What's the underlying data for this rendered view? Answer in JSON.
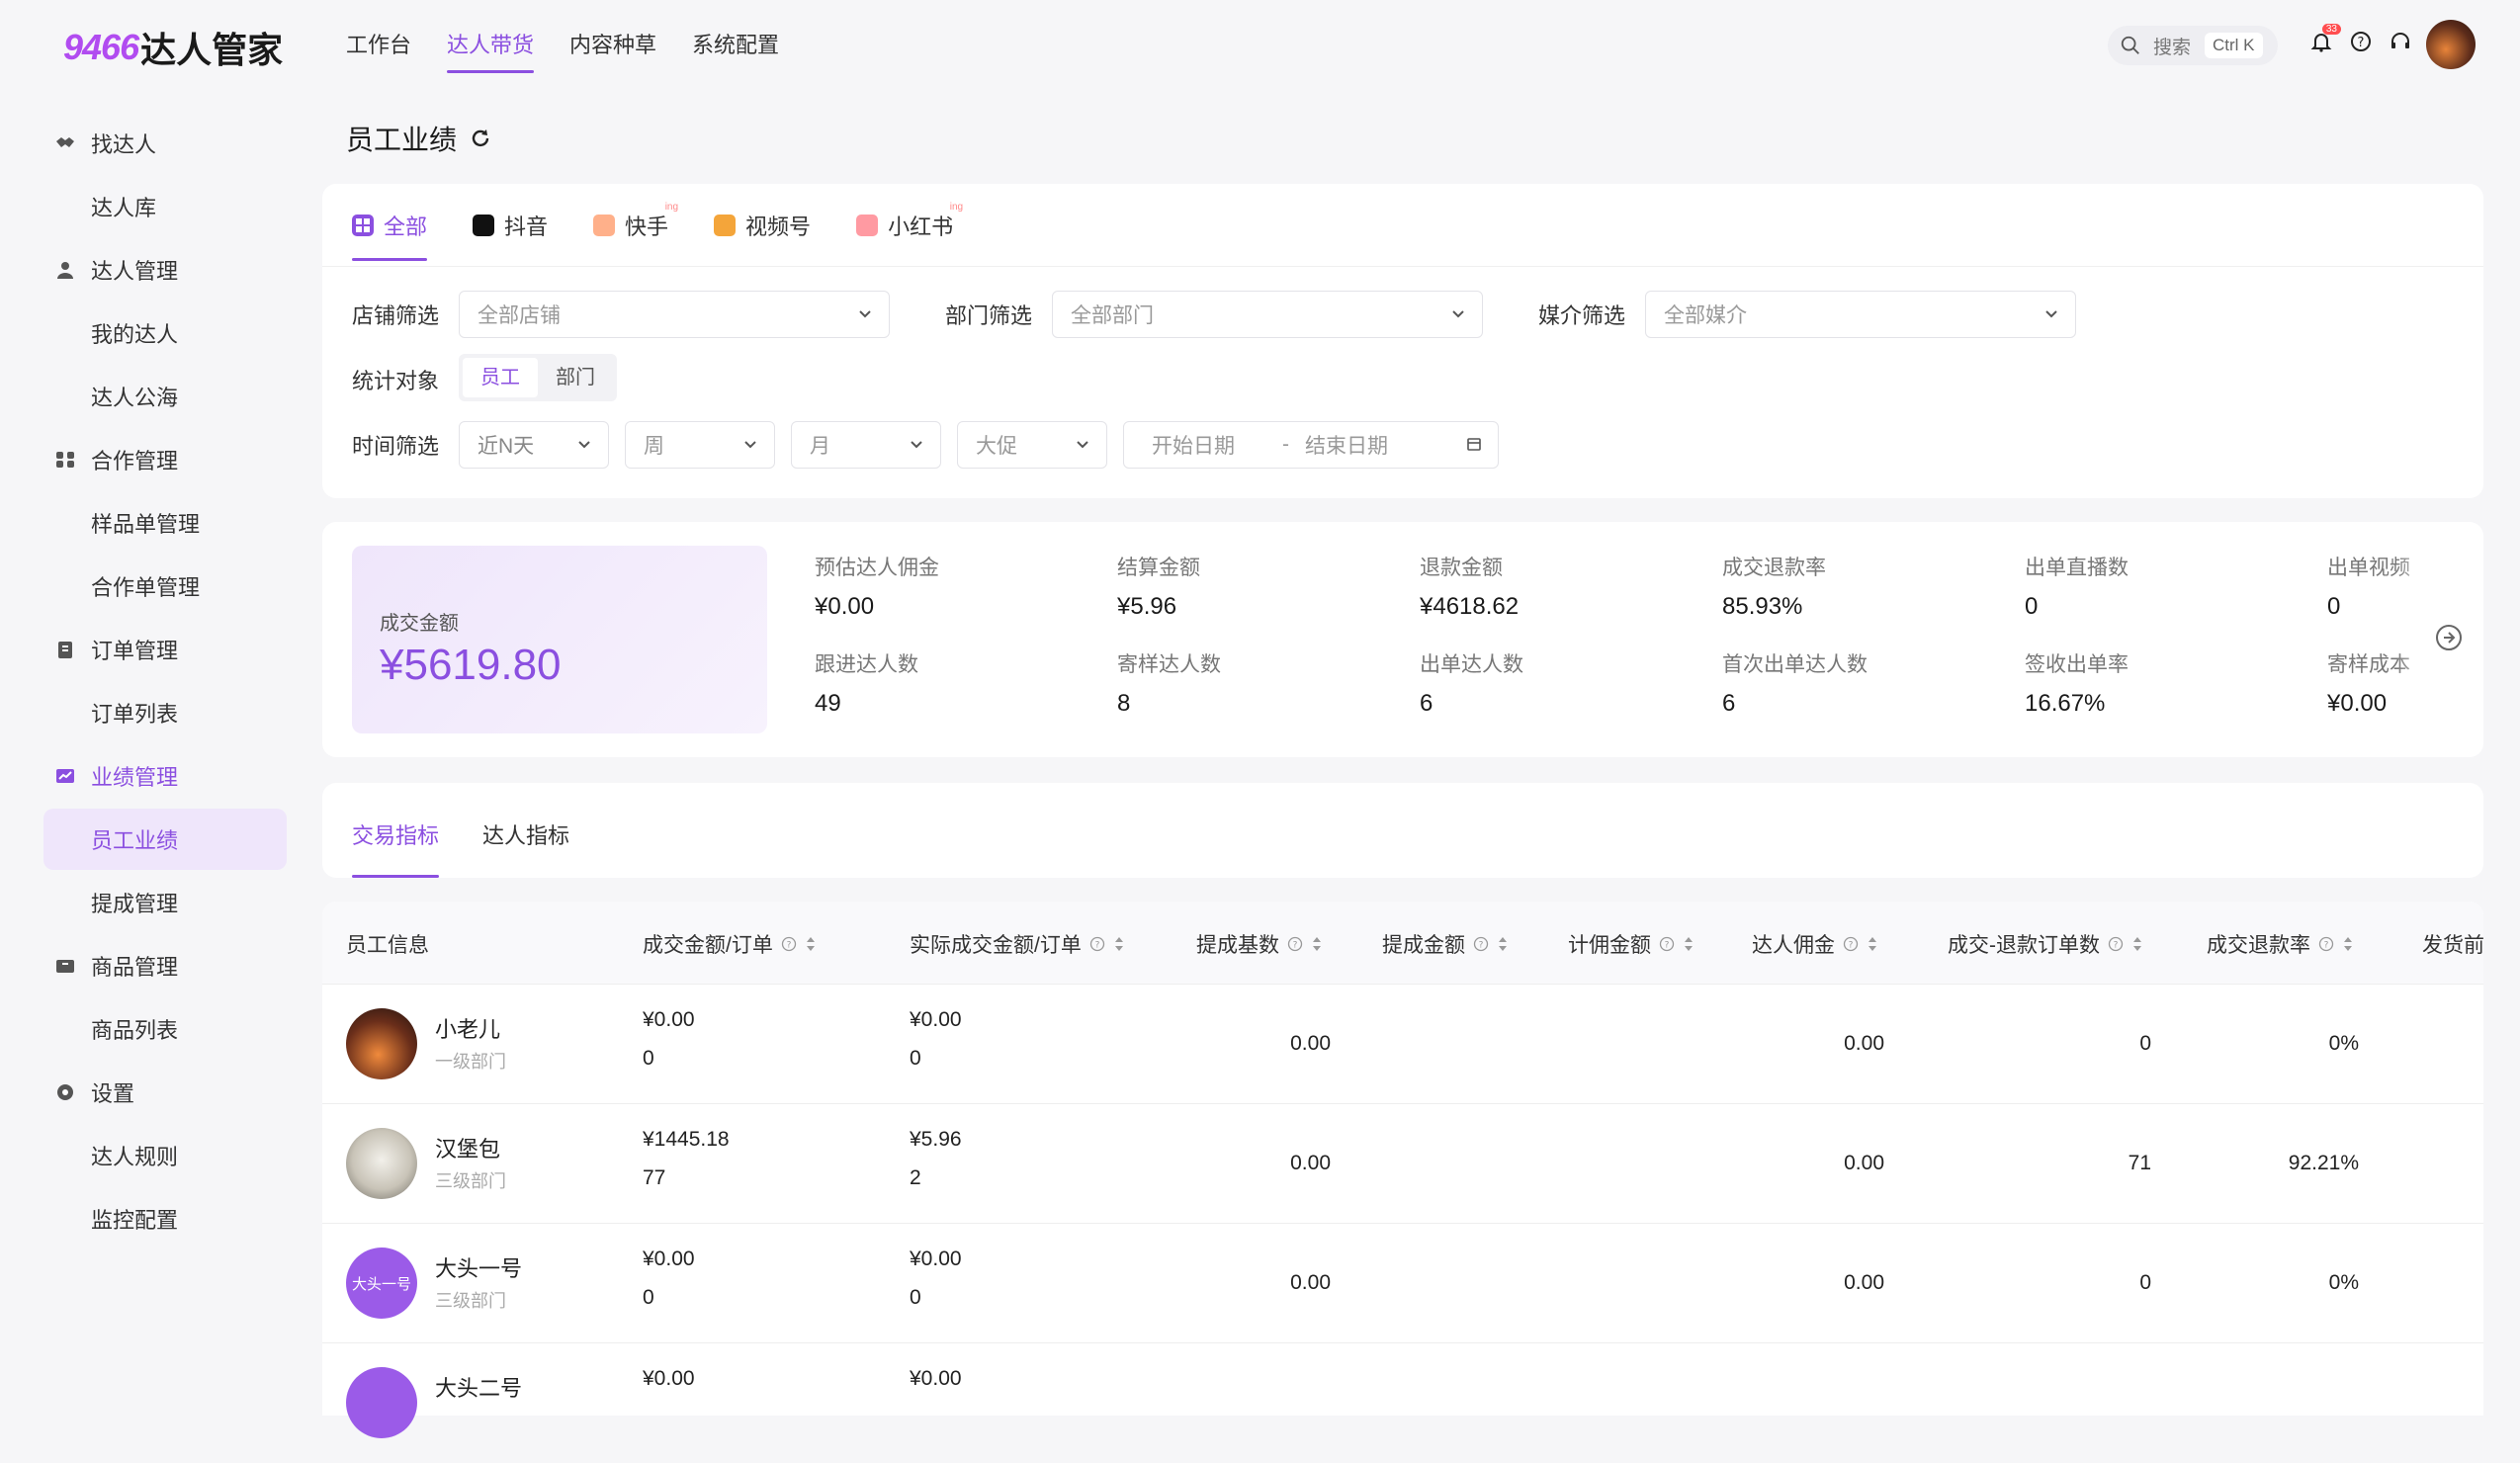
{
  "app": {
    "logo_num": "9466",
    "logo_text": "达人管家",
    "nav": [
      "工作台",
      "达人带货",
      "内容种草",
      "系统配置"
    ],
    "nav_active": "达人带货",
    "search_label": "搜索",
    "search_shortcut": "Ctrl K",
    "notification_count": "33"
  },
  "sidebar": {
    "groups": [
      {
        "label": "找达人",
        "icon": "handshake-icon",
        "items": [
          "达人库"
        ]
      },
      {
        "label": "达人管理",
        "icon": "user-icon",
        "items": [
          "我的达人",
          "达人公海"
        ]
      },
      {
        "label": "合作管理",
        "icon": "team-icon",
        "items": [
          "样品单管理",
          "合作单管理"
        ]
      },
      {
        "label": "订单管理",
        "icon": "clipboard-icon",
        "items": [
          "订单列表"
        ]
      },
      {
        "label": "业绩管理",
        "icon": "chart-icon",
        "items": [
          "员工业绩",
          "提成管理"
        ]
      },
      {
        "label": "商品管理",
        "icon": "box-icon",
        "items": [
          "商品列表"
        ]
      },
      {
        "label": "设置",
        "icon": "gear-icon",
        "items": [
          "达人规则",
          "监控配置"
        ]
      }
    ],
    "active_item": "员工业绩"
  },
  "page": {
    "title": "员工业绩"
  },
  "platforms": [
    {
      "label": "全部",
      "icon": "grid-icon",
      "active": true,
      "tag": ""
    },
    {
      "label": "抖音",
      "icon": "douyin-icon",
      "active": false,
      "tag": ""
    },
    {
      "label": "快手",
      "icon": "kuaishou-icon",
      "active": false,
      "tag": "ing"
    },
    {
      "label": "视频号",
      "icon": "channels-icon",
      "active": false,
      "tag": ""
    },
    {
      "label": "小红书",
      "icon": "xiaohongshu-icon",
      "active": false,
      "tag": "ing"
    }
  ],
  "filters": {
    "shop_label": "店铺筛选",
    "shop_placeholder": "全部店铺",
    "dept_label": "部门筛选",
    "dept_placeholder": "全部部门",
    "agency_label": "媒介筛选",
    "agency_placeholder": "全部媒介",
    "target_label": "统计对象",
    "target_options": [
      "员工",
      "部门"
    ],
    "target_active": "员工",
    "time_label": "时间筛选",
    "time_selects": [
      "近N天",
      "周",
      "月",
      "大促"
    ],
    "start_placeholder": "开始日期",
    "end_placeholder": "结束日期",
    "range_sep": "-"
  },
  "stats": {
    "hero_label": "成交金额",
    "hero_value": "¥5619.80",
    "items": [
      {
        "label": "预估达人佣金",
        "value": "¥0.00"
      },
      {
        "label": "结算金额",
        "value": "¥5.96"
      },
      {
        "label": "退款金额",
        "value": "¥4618.62"
      },
      {
        "label": "成交退款率",
        "value": "85.93%"
      },
      {
        "label": "出单直播数",
        "value": "0"
      },
      {
        "label": "出单视频",
        "value": "0"
      },
      {
        "label": "跟进达人数",
        "value": "49"
      },
      {
        "label": "寄样达人数",
        "value": "8"
      },
      {
        "label": "出单达人数",
        "value": "6"
      },
      {
        "label": "首次出单达人数",
        "value": "6"
      },
      {
        "label": "签收出单率",
        "value": "16.67%"
      },
      {
        "label": "寄样成本",
        "value": "¥0.00"
      }
    ]
  },
  "metric_tabs": {
    "items": [
      "交易指标",
      "达人指标"
    ],
    "active": "交易指标"
  },
  "table": {
    "columns": [
      "员工信息",
      "成交金额/订单",
      "实际成交金额/订单",
      "提成基数",
      "提成金额",
      "计佣金额",
      "达人佣金",
      "成交-退款订单数",
      "成交退款率",
      "发货前"
    ],
    "rows": [
      {
        "name": "小老儿",
        "dept": "一级部门",
        "gmv": "¥0.00",
        "orders": "0",
        "real_gmv": "¥0.00",
        "real_orders": "0",
        "base": "0.00",
        "commission": "",
        "calc": "",
        "talent_comm": "0.00",
        "refund_orders": "0",
        "refund_rate": "0%",
        "avatar": "sunset"
      },
      {
        "name": "汉堡包",
        "dept": "三级部门",
        "gmv": "¥1445.18",
        "orders": "77",
        "real_gmv": "¥5.96",
        "real_orders": "2",
        "base": "0.00",
        "commission": "",
        "calc": "",
        "talent_comm": "0.00",
        "refund_orders": "71",
        "refund_rate": "92.21%",
        "avatar": "dog"
      },
      {
        "name": "大头一号",
        "dept": "三级部门",
        "gmv": "¥0.00",
        "orders": "0",
        "real_gmv": "¥0.00",
        "real_orders": "0",
        "base": "0.00",
        "commission": "",
        "calc": "",
        "talent_comm": "0.00",
        "refund_orders": "0",
        "refund_rate": "0%",
        "avatar": "大头一号"
      },
      {
        "name": "大头二号",
        "dept": "",
        "gmv": "¥0.00",
        "orders": "",
        "real_gmv": "¥0.00",
        "real_orders": "",
        "base": "",
        "commission": "",
        "calc": "",
        "talent_comm": "",
        "refund_orders": "",
        "refund_rate": "",
        "avatar": ""
      }
    ]
  },
  "colors": {
    "accent": "#8b4fe0",
    "accent_light": "#efe6fb"
  }
}
